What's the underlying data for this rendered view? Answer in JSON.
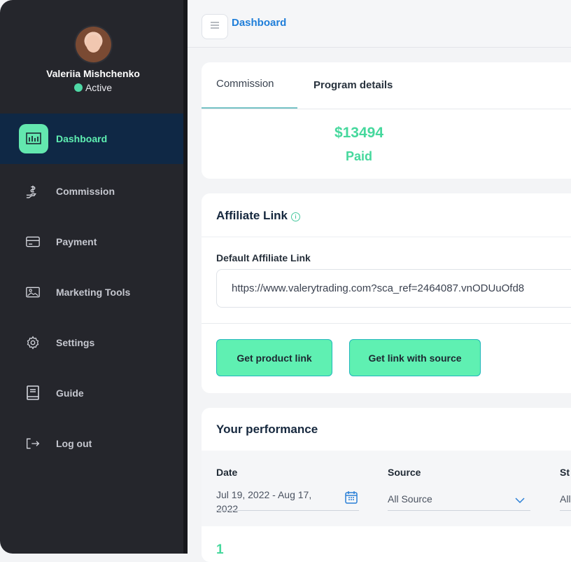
{
  "user": {
    "name": "Valeriia Mishchenko",
    "status": "Active"
  },
  "nav": {
    "items": [
      {
        "label": "Dashboard",
        "icon": "bar-chart-icon"
      },
      {
        "label": "Commission",
        "icon": "hand-dollar-icon"
      },
      {
        "label": "Payment",
        "icon": "credit-card-icon"
      },
      {
        "label": "Marketing Tools",
        "icon": "image-icon"
      },
      {
        "label": "Settings",
        "icon": "gear-icon"
      },
      {
        "label": "Guide",
        "icon": "book-icon"
      },
      {
        "label": "Log out",
        "icon": "logout-icon"
      }
    ]
  },
  "breadcrumb": "Dashboard",
  "commission_card": {
    "tabs": [
      "Commission",
      "Program details"
    ],
    "amount": "$13494",
    "amount_label": "Paid"
  },
  "affiliate": {
    "title": "Affiliate Link",
    "field_label": "Default Affiliate Link",
    "link": "https://www.valerytrading.com?sca_ref=2464087.vnODUuOfd8",
    "buttons": [
      "Get product link",
      "Get link with source"
    ]
  },
  "performance": {
    "title": "Your performance",
    "filters": [
      {
        "label": "Date",
        "value": "Jul 19, 2022 - Aug 17, 2022"
      },
      {
        "label": "Source",
        "value": "All Source"
      },
      {
        "label": "St",
        "value": "All"
      }
    ],
    "first_value": "1"
  },
  "colors": {
    "accent": "#5ff0b2",
    "sidebar": "#25262c",
    "link": "#1f7ed9"
  }
}
